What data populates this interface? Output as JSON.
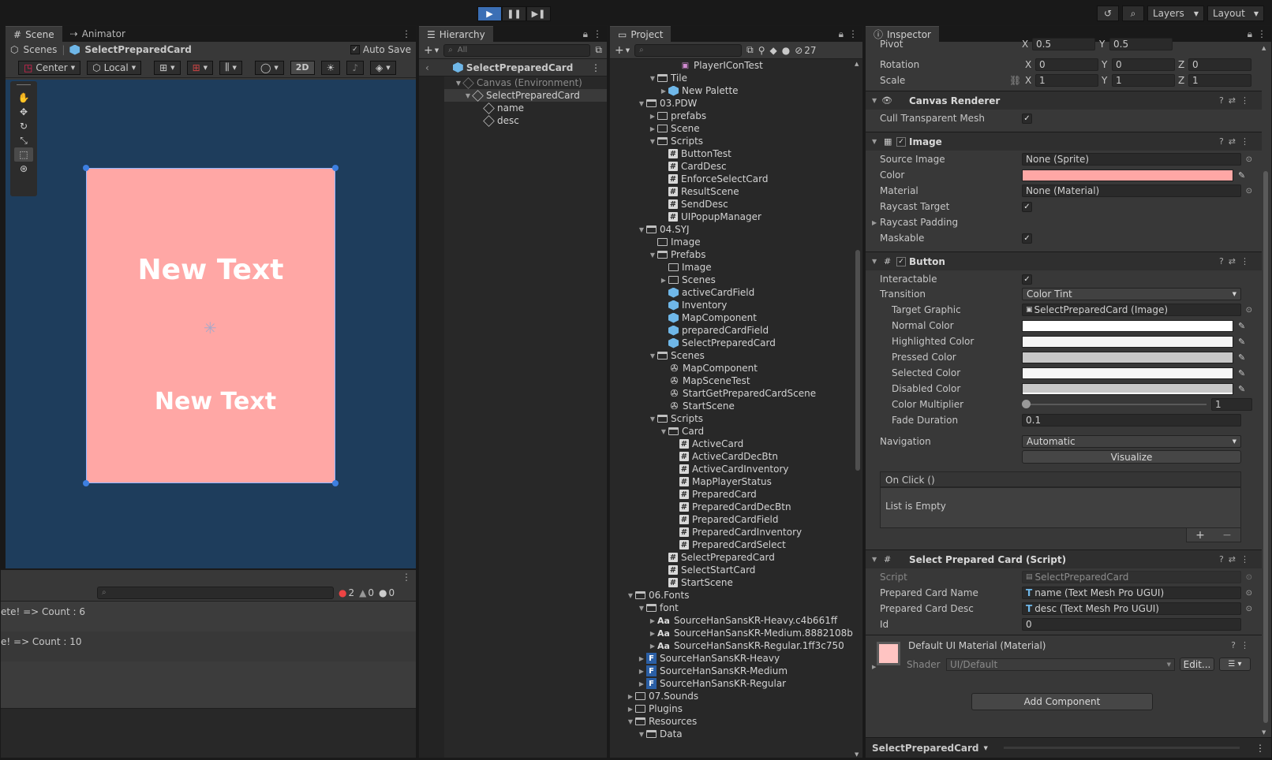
{
  "toolbar": {
    "layers": "Layers",
    "layout": "Layout"
  },
  "scene": {
    "tabs": [
      "Scene",
      "Animator"
    ],
    "breadcrumb_root": "Scenes",
    "breadcrumb_item": "SelectPreparedCard",
    "auto_save": "Auto Save",
    "pivot": "Center",
    "space": "Local",
    "mode_2d": "2D",
    "card_text_top": "New Text",
    "card_text_bottom": "New Text",
    "card_color": "#ffa7a5",
    "scene_bg": "#1e3d5c"
  },
  "console": {
    "line1": "ete! => Count : 6",
    "line2": "e! => Count : 10",
    "errors": "2",
    "warnings": "0",
    "infos": "0"
  },
  "hierarchy": {
    "title": "Hierarchy",
    "search_placeholder": "All",
    "root": "SelectPreparedCard",
    "items": [
      {
        "label": "Canvas (Environment)"
      },
      {
        "label": "SelectPreparedCard"
      },
      {
        "label": "name"
      },
      {
        "label": "desc"
      }
    ]
  },
  "project": {
    "title": "Project",
    "hidden_count": "27",
    "items": [
      "PlayerIConTest",
      "Tile",
      "New Palette",
      "03.PDW",
      "prefabs",
      "Scene",
      "Scripts",
      "ButtonTest",
      "CardDesc",
      "EnforceSelectCard",
      "ResultScene",
      "SendDesc",
      "UIPopupManager",
      "04.SYJ",
      "Image",
      "Prefabs",
      "Image",
      "Scenes",
      "activeCardField",
      "Inventory",
      "MapComponent",
      "preparedCardField",
      "SelectPreparedCard",
      "Scenes",
      "MapComponent",
      "MapSceneTest",
      "StartGetPreparedCardScene",
      "StartScene",
      "Scripts",
      "Card",
      "ActiveCard",
      "ActiveCardDecBtn",
      "ActiveCardInventory",
      "MapPlayerStatus",
      "PreparedCard",
      "PreparedCardDecBtn",
      "PreparedCardField",
      "PreparedCardInventory",
      "PreparedCardSelect",
      "SelectPreparedCard",
      "SelectStartCard",
      "StartScene",
      "06.Fonts",
      "font",
      "SourceHanSansKR-Heavy.c4b661ff",
      "SourceHanSansKR-Medium.8882108b",
      "SourceHanSansKR-Regular.1ff3c750",
      "SourceHanSansKR-Heavy",
      "SourceHanSansKR-Medium",
      "SourceHanSansKR-Regular",
      "07.Sounds",
      "Plugins",
      "Resources",
      "Data"
    ]
  },
  "inspector": {
    "title": "Inspector",
    "pivot": {
      "label": "Pivot",
      "x": "0.5",
      "y": "0.5"
    },
    "rotation": {
      "label": "Rotation",
      "x": "0",
      "y": "0",
      "z": "0"
    },
    "scale": {
      "label": "Scale",
      "x": "1",
      "y": "1",
      "z": "1"
    },
    "canvas_renderer": {
      "title": "Canvas Renderer",
      "cull": "Cull Transparent Mesh"
    },
    "image": {
      "title": "Image",
      "source_image": "Source Image",
      "source_value": "None (Sprite)",
      "color": "Color",
      "color_value": "#ffa7a5",
      "material": "Material",
      "material_value": "None (Material)",
      "raycast_target": "Raycast Target",
      "raycast_padding": "Raycast Padding",
      "maskable": "Maskable"
    },
    "button": {
      "title": "Button",
      "interactable": "Interactable",
      "transition": "Transition",
      "transition_value": "Color Tint",
      "target_graphic": "Target Graphic",
      "target_value": "SelectPreparedCard (Image)",
      "normal": "Normal Color",
      "highlighted": "Highlighted Color",
      "pressed": "Pressed Color",
      "selected": "Selected Color",
      "disabled": "Disabled Color",
      "multiplier": "Color Multiplier",
      "multiplier_value": "1",
      "fade": "Fade Duration",
      "fade_value": "0.1",
      "navigation": "Navigation",
      "navigation_value": "Automatic",
      "visualize": "Visualize",
      "onclick": "On Click ()",
      "empty": "List is Empty"
    },
    "script": {
      "title": "Select Prepared Card (Script)",
      "script": "Script",
      "script_value": "SelectPreparedCard",
      "name": "Prepared Card Name",
      "name_value": "name (Text Mesh Pro UGUI)",
      "desc": "Prepared Card Desc",
      "desc_value": "desc (Text Mesh Pro UGUI)",
      "id": "Id",
      "id_value": "0"
    },
    "material": {
      "title": "Default UI Material (Material)",
      "shader": "Shader",
      "shader_value": "UI/Default",
      "edit": "Edit..."
    },
    "add_component": "Add Component",
    "footer": "SelectPreparedCard"
  }
}
